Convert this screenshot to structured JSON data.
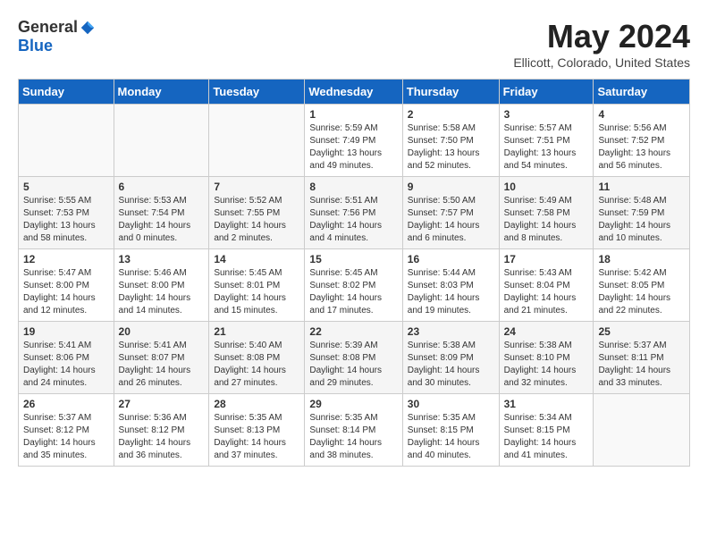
{
  "logo": {
    "general": "General",
    "blue": "Blue"
  },
  "title": "May 2024",
  "location": "Ellicott, Colorado, United States",
  "days_of_week": [
    "Sunday",
    "Monday",
    "Tuesday",
    "Wednesday",
    "Thursday",
    "Friday",
    "Saturday"
  ],
  "weeks": [
    [
      {
        "day": "",
        "content": ""
      },
      {
        "day": "",
        "content": ""
      },
      {
        "day": "",
        "content": ""
      },
      {
        "day": "1",
        "content": "Sunrise: 5:59 AM\nSunset: 7:49 PM\nDaylight: 13 hours\nand 49 minutes."
      },
      {
        "day": "2",
        "content": "Sunrise: 5:58 AM\nSunset: 7:50 PM\nDaylight: 13 hours\nand 52 minutes."
      },
      {
        "day": "3",
        "content": "Sunrise: 5:57 AM\nSunset: 7:51 PM\nDaylight: 13 hours\nand 54 minutes."
      },
      {
        "day": "4",
        "content": "Sunrise: 5:56 AM\nSunset: 7:52 PM\nDaylight: 13 hours\nand 56 minutes."
      }
    ],
    [
      {
        "day": "5",
        "content": "Sunrise: 5:55 AM\nSunset: 7:53 PM\nDaylight: 13 hours\nand 58 minutes."
      },
      {
        "day": "6",
        "content": "Sunrise: 5:53 AM\nSunset: 7:54 PM\nDaylight: 14 hours\nand 0 minutes."
      },
      {
        "day": "7",
        "content": "Sunrise: 5:52 AM\nSunset: 7:55 PM\nDaylight: 14 hours\nand 2 minutes."
      },
      {
        "day": "8",
        "content": "Sunrise: 5:51 AM\nSunset: 7:56 PM\nDaylight: 14 hours\nand 4 minutes."
      },
      {
        "day": "9",
        "content": "Sunrise: 5:50 AM\nSunset: 7:57 PM\nDaylight: 14 hours\nand 6 minutes."
      },
      {
        "day": "10",
        "content": "Sunrise: 5:49 AM\nSunset: 7:58 PM\nDaylight: 14 hours\nand 8 minutes."
      },
      {
        "day": "11",
        "content": "Sunrise: 5:48 AM\nSunset: 7:59 PM\nDaylight: 14 hours\nand 10 minutes."
      }
    ],
    [
      {
        "day": "12",
        "content": "Sunrise: 5:47 AM\nSunset: 8:00 PM\nDaylight: 14 hours\nand 12 minutes."
      },
      {
        "day": "13",
        "content": "Sunrise: 5:46 AM\nSunset: 8:00 PM\nDaylight: 14 hours\nand 14 minutes."
      },
      {
        "day": "14",
        "content": "Sunrise: 5:45 AM\nSunset: 8:01 PM\nDaylight: 14 hours\nand 15 minutes."
      },
      {
        "day": "15",
        "content": "Sunrise: 5:45 AM\nSunset: 8:02 PM\nDaylight: 14 hours\nand 17 minutes."
      },
      {
        "day": "16",
        "content": "Sunrise: 5:44 AM\nSunset: 8:03 PM\nDaylight: 14 hours\nand 19 minutes."
      },
      {
        "day": "17",
        "content": "Sunrise: 5:43 AM\nSunset: 8:04 PM\nDaylight: 14 hours\nand 21 minutes."
      },
      {
        "day": "18",
        "content": "Sunrise: 5:42 AM\nSunset: 8:05 PM\nDaylight: 14 hours\nand 22 minutes."
      }
    ],
    [
      {
        "day": "19",
        "content": "Sunrise: 5:41 AM\nSunset: 8:06 PM\nDaylight: 14 hours\nand 24 minutes."
      },
      {
        "day": "20",
        "content": "Sunrise: 5:41 AM\nSunset: 8:07 PM\nDaylight: 14 hours\nand 26 minutes."
      },
      {
        "day": "21",
        "content": "Sunrise: 5:40 AM\nSunset: 8:08 PM\nDaylight: 14 hours\nand 27 minutes."
      },
      {
        "day": "22",
        "content": "Sunrise: 5:39 AM\nSunset: 8:08 PM\nDaylight: 14 hours\nand 29 minutes."
      },
      {
        "day": "23",
        "content": "Sunrise: 5:38 AM\nSunset: 8:09 PM\nDaylight: 14 hours\nand 30 minutes."
      },
      {
        "day": "24",
        "content": "Sunrise: 5:38 AM\nSunset: 8:10 PM\nDaylight: 14 hours\nand 32 minutes."
      },
      {
        "day": "25",
        "content": "Sunrise: 5:37 AM\nSunset: 8:11 PM\nDaylight: 14 hours\nand 33 minutes."
      }
    ],
    [
      {
        "day": "26",
        "content": "Sunrise: 5:37 AM\nSunset: 8:12 PM\nDaylight: 14 hours\nand 35 minutes."
      },
      {
        "day": "27",
        "content": "Sunrise: 5:36 AM\nSunset: 8:12 PM\nDaylight: 14 hours\nand 36 minutes."
      },
      {
        "day": "28",
        "content": "Sunrise: 5:35 AM\nSunset: 8:13 PM\nDaylight: 14 hours\nand 37 minutes."
      },
      {
        "day": "29",
        "content": "Sunrise: 5:35 AM\nSunset: 8:14 PM\nDaylight: 14 hours\nand 38 minutes."
      },
      {
        "day": "30",
        "content": "Sunrise: 5:35 AM\nSunset: 8:15 PM\nDaylight: 14 hours\nand 40 minutes."
      },
      {
        "day": "31",
        "content": "Sunrise: 5:34 AM\nSunset: 8:15 PM\nDaylight: 14 hours\nand 41 minutes."
      },
      {
        "day": "",
        "content": ""
      }
    ]
  ]
}
